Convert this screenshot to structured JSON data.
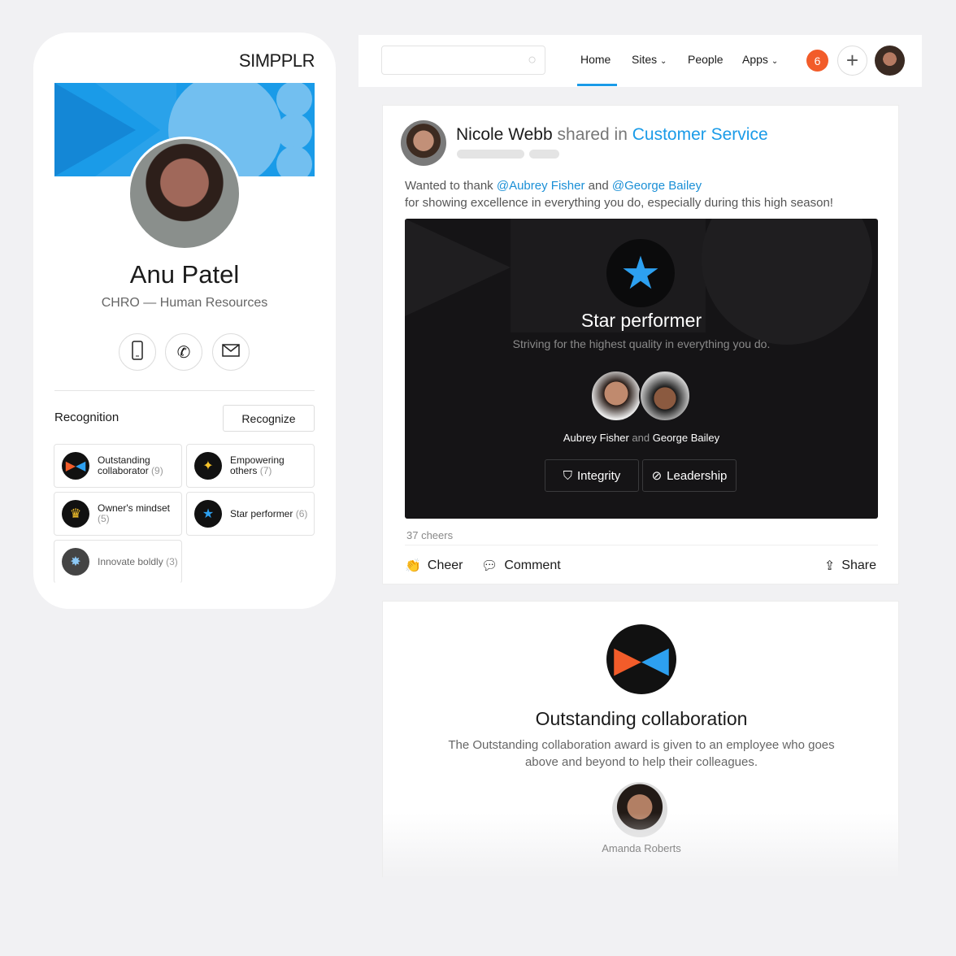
{
  "profile": {
    "logo": "SIMPPLR",
    "name": "Anu Patel",
    "role": "CHRO — Human Resources",
    "contact_icons": [
      "mobile-icon",
      "phone-icon",
      "mail-icon"
    ],
    "recognition_title": "Recognition",
    "recognize_label": "Recognize",
    "badges": [
      {
        "label": "Outstanding collaborator",
        "count": "(9)",
        "icon": "collaboration-icon"
      },
      {
        "label": "Empowering others",
        "count": "(7)",
        "icon": "sparkle-icon"
      },
      {
        "label": "Owner's mindset",
        "count": "(5)",
        "icon": "crown-icon"
      },
      {
        "label": "Star performer",
        "count": "(6)",
        "icon": "star-icon"
      },
      {
        "label": "Innovate boldly",
        "count": "(3)",
        "icon": "burst-icon"
      }
    ]
  },
  "topbar": {
    "search_placeholder": "",
    "nav": [
      "Home",
      "Sites",
      "People",
      "Apps"
    ],
    "active": "Home",
    "notifications": "6"
  },
  "post": {
    "author": "Nicole Webb",
    "verb": "shared in",
    "site": "Customer Service",
    "text_prefix": "Wanted to thank",
    "mention1": "@Aubrey Fisher",
    "and": "and",
    "mention2": "@George Bailey",
    "text_line2": "for showing excellence in everything you do, especially during this high season!",
    "award_title": "Star performer",
    "award_sub": "Striving for the highest quality in everything you do.",
    "recipient1": "Aubrey Fisher",
    "recipients_and": "and",
    "recipient2": "George Bailey",
    "values": [
      "Integrity",
      "Leadership"
    ],
    "cheers": "37 cheers",
    "actions": {
      "cheer": "Cheer",
      "comment": "Comment",
      "share": "Share"
    }
  },
  "award_card": {
    "title": "Outstanding collaboration",
    "description": "The Outstanding collaboration award is given to an employee who goes above and beyond to help their colleagues.",
    "recipient": "Amanda Roberts"
  },
  "colors": {
    "accent": "#1a9be8",
    "notification": "#f25c2a",
    "dark_card": "#151416"
  }
}
